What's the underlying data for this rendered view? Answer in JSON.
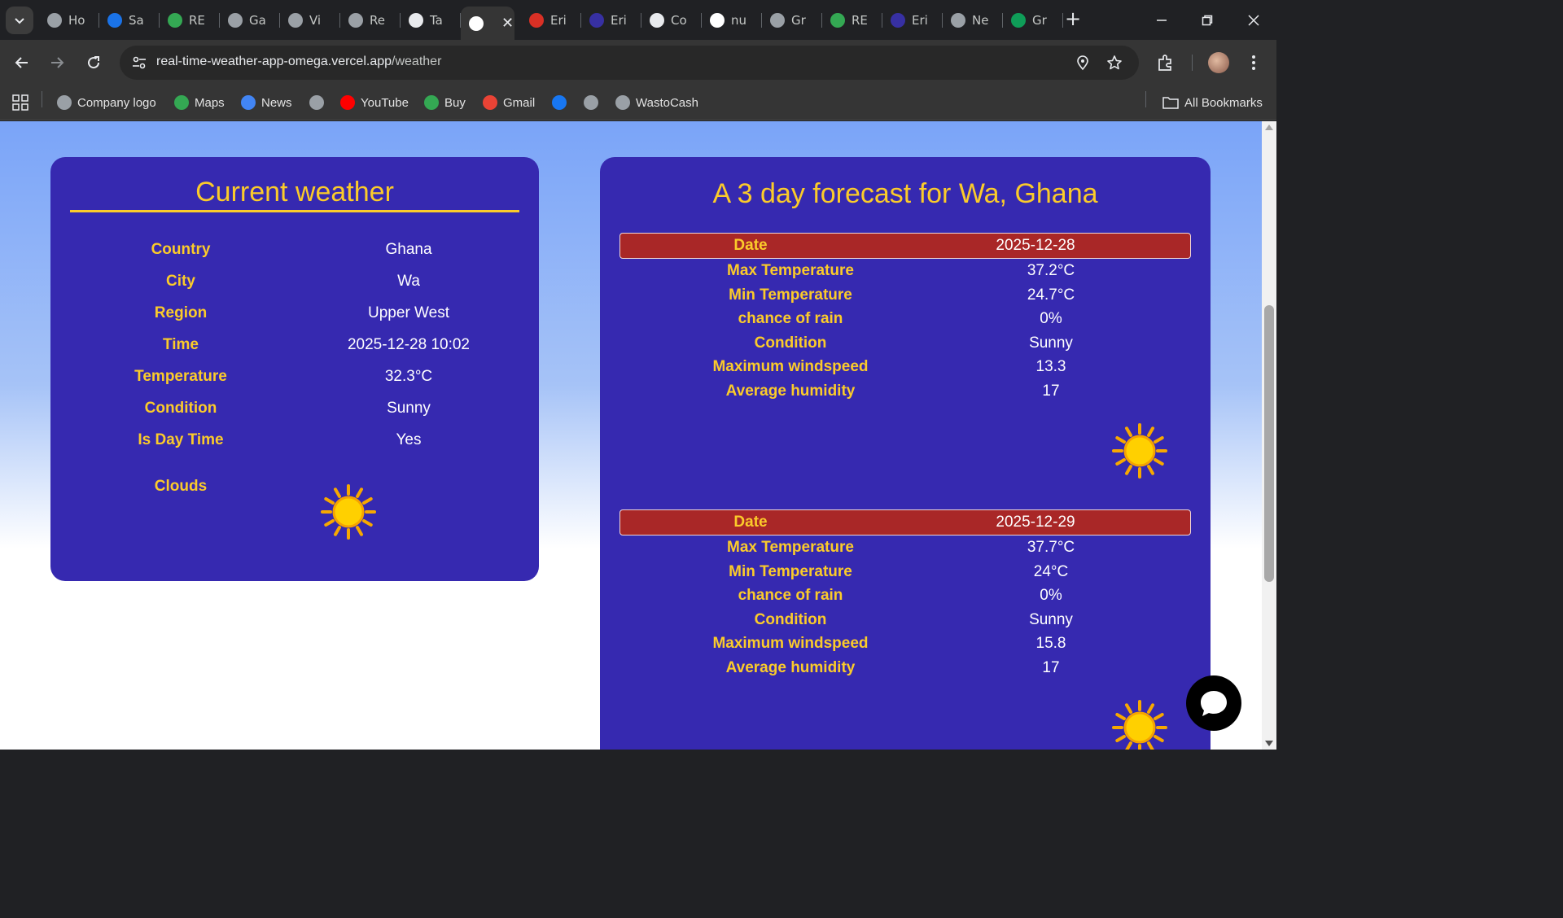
{
  "browser": {
    "tabs": [
      {
        "label": "Ho",
        "icon": "globe-icon",
        "color": "#9aa0a6"
      },
      {
        "label": "Sa",
        "icon": "droplet-icon",
        "color": "#1a73e8"
      },
      {
        "label": "RE",
        "icon": "leaf-icon",
        "color": "#34a853"
      },
      {
        "label": "Ga",
        "icon": "globe-icon",
        "color": "#9aa0a6"
      },
      {
        "label": "Vi",
        "icon": "globe-icon",
        "color": "#9aa0a6"
      },
      {
        "label": "Re",
        "icon": "globe-icon",
        "color": "#9aa0a6"
      },
      {
        "label": "Ta",
        "icon": "waves-icon",
        "color": "#e8eaed"
      },
      {
        "label": "",
        "icon": "cloud-sun-icon",
        "color": "#ffffff",
        "active": true
      },
      {
        "label": "Eri",
        "icon": "pin-icon",
        "color": "#d93025"
      },
      {
        "label": "Eri",
        "icon": "em-icon",
        "color": "#3730a3"
      },
      {
        "label": "Co",
        "icon": "openai-icon",
        "color": "#e8eaed"
      },
      {
        "label": "nu",
        "icon": "google-icon",
        "color": "#ffffff"
      },
      {
        "label": "Gr",
        "icon": "globe-icon",
        "color": "#9aa0a6"
      },
      {
        "label": "RE",
        "icon": "leaf-icon",
        "color": "#34a853"
      },
      {
        "label": "Eri",
        "icon": "em-icon",
        "color": "#3730a3"
      },
      {
        "label": "Ne",
        "icon": "chrome-icon",
        "color": "#9aa0a6"
      },
      {
        "label": "Gr",
        "icon": "sheets-icon",
        "color": "#0f9d58"
      }
    ],
    "url_host": "real-time-weather-app-omega.vercel.app",
    "url_path": "/weather",
    "bookmarks": [
      {
        "label": "Company logo",
        "icon": "globe-icon",
        "color": "#9aa0a6"
      },
      {
        "label": "Maps",
        "icon": "maps-pin-icon",
        "color": "#34a853"
      },
      {
        "label": "News",
        "icon": "news-icon",
        "color": "#4285f4"
      },
      {
        "label": "",
        "icon": "globe-icon",
        "color": "#9aa0a6"
      },
      {
        "label": "YouTube",
        "icon": "youtube-icon",
        "color": "#ff0000"
      },
      {
        "label": "Buy",
        "icon": "leaf-icon",
        "color": "#34a853"
      },
      {
        "label": "Gmail",
        "icon": "gmail-icon",
        "color": "#ea4335"
      },
      {
        "label": "",
        "icon": "facebook-icon",
        "color": "#1877f2"
      },
      {
        "label": "",
        "icon": "globe-icon",
        "color": "#9aa0a6"
      },
      {
        "label": "WastoCash",
        "icon": "globe-icon",
        "color": "#9aa0a6"
      }
    ],
    "all_bookmarks": "All Bookmarks"
  },
  "current": {
    "title": "Current weather",
    "rows": [
      {
        "label": "Country",
        "value": "Ghana"
      },
      {
        "label": "City",
        "value": "Wa"
      },
      {
        "label": "Region",
        "value": "Upper West"
      },
      {
        "label": "Time",
        "value": "2025-12-28 10:02"
      },
      {
        "label": "Temperature",
        "value": "32.3°C"
      },
      {
        "label": "Condition",
        "value": "Sunny"
      },
      {
        "label": "Is Day Time",
        "value": "Yes"
      }
    ],
    "clouds_label": "Clouds",
    "clouds_icon": "sun-icon"
  },
  "forecast": {
    "title": "A 3 day forecast for Wa, Ghana",
    "date_label": "Date",
    "days": [
      {
        "date": "2025-12-28",
        "rows": [
          {
            "label": "Max Temperature",
            "value": "37.2°C"
          },
          {
            "label": "Min Temperature",
            "value": "24.7°C"
          },
          {
            "label": "chance of rain",
            "value": "0%"
          },
          {
            "label": "Condition",
            "value": "Sunny"
          },
          {
            "label": "Maximum windspeed",
            "value": "13.3"
          },
          {
            "label": "Average humidity",
            "value": "17"
          }
        ]
      },
      {
        "date": "2025-12-29",
        "rows": [
          {
            "label": "Max Temperature",
            "value": "37.7°C"
          },
          {
            "label": "Min Temperature",
            "value": "24°C"
          },
          {
            "label": "chance of rain",
            "value": "0%"
          },
          {
            "label": "Condition",
            "value": "Sunny"
          },
          {
            "label": "Maximum windspeed",
            "value": "15.8"
          },
          {
            "label": "Average humidity",
            "value": "17"
          }
        ]
      }
    ]
  },
  "colors": {
    "card": "#3629b0",
    "accent": "#fbcb2a",
    "date_bar": "#a92727"
  }
}
